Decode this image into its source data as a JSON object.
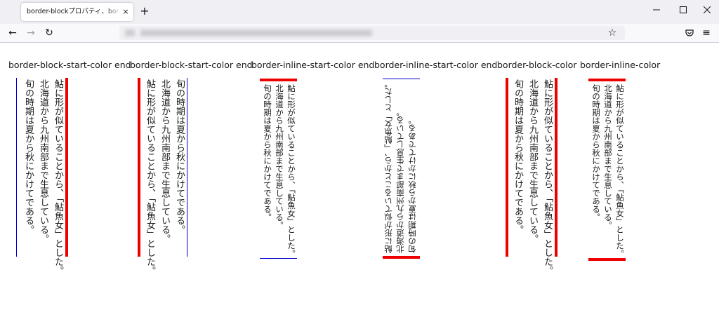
{
  "browser": {
    "tab_title": "border-blockプロパティ、border-inline",
    "tab_close": "×",
    "new_tab": "+",
    "url": "",
    "window_controls": {
      "minimize": "—",
      "maximize": "☐",
      "close": "✕"
    },
    "nav": {
      "back": "←",
      "forward": "→",
      "reload": "↻",
      "bookmark": "☆",
      "pocket": "◡",
      "menu": "≡"
    }
  },
  "examples": [
    {
      "label": "border-block-start-color end",
      "lines": [
        "鮎に形が似ていることから、「鮎魚女」とした。",
        "北海道から九州南部まで生息している。",
        "旬の時期は夏から秋にかけてである。"
      ]
    },
    {
      "label": "border-block-start-color end",
      "lines": [
        "旬の時期は夏から秋にかけてである。",
        "北海道から九州南部まで生息している。",
        "鮎に形が似ていることから、「鮎魚女」とした。"
      ]
    },
    {
      "label": "border-inline-start-color end",
      "lines": [
        "鮎に形が似ていることから、「鮎魚女」とした。",
        "北海道から九州南部まで生息している。",
        "旬の時期は夏から秋にかけてである。"
      ]
    },
    {
      "label": "border-inline-start-color end",
      "lines": [
        "鮎に形が似ていることから、「鮎魚女」とした。",
        "北海道から九州南部まで生息している。",
        "旬の時期は夏から秋にかけてである。"
      ]
    },
    {
      "label": "border-block-color",
      "lines": [
        "鮎に形が似ていることから、「鮎魚女」とした。",
        "北海道から九州南部まで生息している。",
        "旬の時期は夏から秋にかけてである。"
      ]
    },
    {
      "label": "border-inline-color",
      "lines": [
        "鮎に形が似ていることから、「鮎魚女」とした。",
        "北海道から九州南部まで生息している。",
        "旬の時期は夏から秋にかけてである。"
      ]
    }
  ],
  "colors": {
    "accent_border": "#ee0000",
    "thin_border": "#0000cc"
  }
}
